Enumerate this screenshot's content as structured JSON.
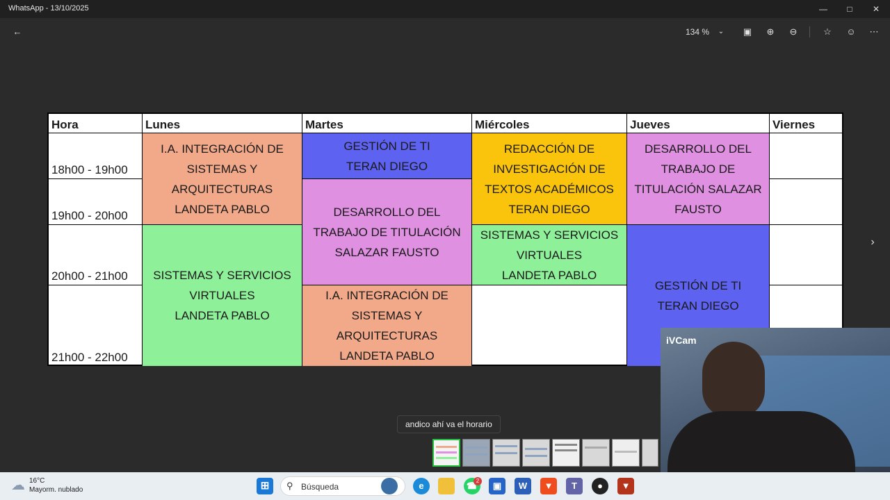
{
  "window": {
    "title": "WhatsApp - 13/10/2025"
  },
  "toolbar": {
    "zoom": "134 %"
  },
  "schedule": {
    "headers": [
      "Hora",
      "Lunes",
      "Martes",
      "Miércoles",
      "Jueves",
      "Viernes"
    ],
    "times": [
      "18h00 - 19h00",
      "19h00 - 20h00",
      "20h00 - 21h00",
      "21h00 - 22h00"
    ],
    "blocks": {
      "lunes_1": "I.A. INTEGRACIÓN DE\nSISTEMAS Y\nARQUITECTURAS\nLANDETA  PABLO",
      "lunes_2": "SISTEMAS Y SERVICIOS\nVIRTUALES\nLANDETA  PABLO",
      "martes_1": "GESTIÓN DE TI\nTERAN DIEGO",
      "martes_2": "DESARROLLO DEL\nTRABAJO DE TITULACIÓN\nSALAZAR  FAUSTO",
      "martes_3": "I.A. INTEGRACIÓN DE\nSISTEMAS Y\nARQUITECTURAS\nLANDETA  PABLO",
      "miercoles_1": "REDACCIÓN DE\nINVESTIGACIÓN DE\nTEXTOS ACADÉMICOS\nTERAN DIEGO",
      "miercoles_2": "SISTEMAS Y SERVICIOS\nVIRTUALES\nLANDETA  PABLO",
      "jueves_1": "DESARROLLO DEL\nTRABAJO DE\nTITULACIÓN SALAZAR\nFAUSTO",
      "jueves_2": "GESTIÓN DE TI\nTERAN DIEGO"
    },
    "colors": {
      "salmon": "#f2a98a",
      "blue": "#5d62f0",
      "pink": "#df90e0",
      "yellow": "#fbc40c",
      "green": "#8ff09a"
    }
  },
  "webcam": {
    "label": "iVCam"
  },
  "tooltip": "andico ahí va el horario",
  "taskbar": {
    "weather_temp": "16°C",
    "weather_desc": "Mayorm. nublado",
    "search_placeholder": "Búsqueda",
    "whatsapp_badge": "2",
    "word_icon": "W"
  }
}
